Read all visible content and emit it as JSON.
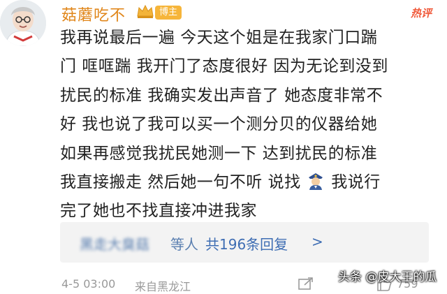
{
  "comment": {
    "username": "菇蘑吃不",
    "host_badge": "博主",
    "hot_tag": "热评",
    "content_lines": [
      "我再说最后一遍 今天这个姐是在我家门口踹",
      "门 哐哐踹 我开门了态度很好 因为无论到没到",
      "扰民的标准 我确实发出声音了 她态度非常不",
      "好 我也说了我可以买一个测分贝的仪器给她",
      "如果再感觉我扰民她测一下 达到扰民的标准",
      "我直接搬走 然后她一句不听 说找",
      "完了她也不找直接冲进我家"
    ],
    "content_line6_tail": "我说行",
    "replies": {
      "names": "黑走大臭菇",
      "etc": "等人",
      "count_text": "共196条回复",
      "arrow": ">"
    },
    "meta": {
      "time": "4-5 03:00",
      "source": "来自黑龙江",
      "like_count": "759"
    }
  },
  "watermark": "头条 @皮大王的瓜",
  "icons": {
    "crown": "crown-icon",
    "police": "police-officer-emoji",
    "share": "share-icon",
    "like": "thumbs-up-icon"
  },
  "colors": {
    "username": "#e0861a",
    "badge": "#f6b53a",
    "hot": "#f0593a",
    "link": "#3e6db3",
    "text": "#222222",
    "meta": "#999999"
  }
}
